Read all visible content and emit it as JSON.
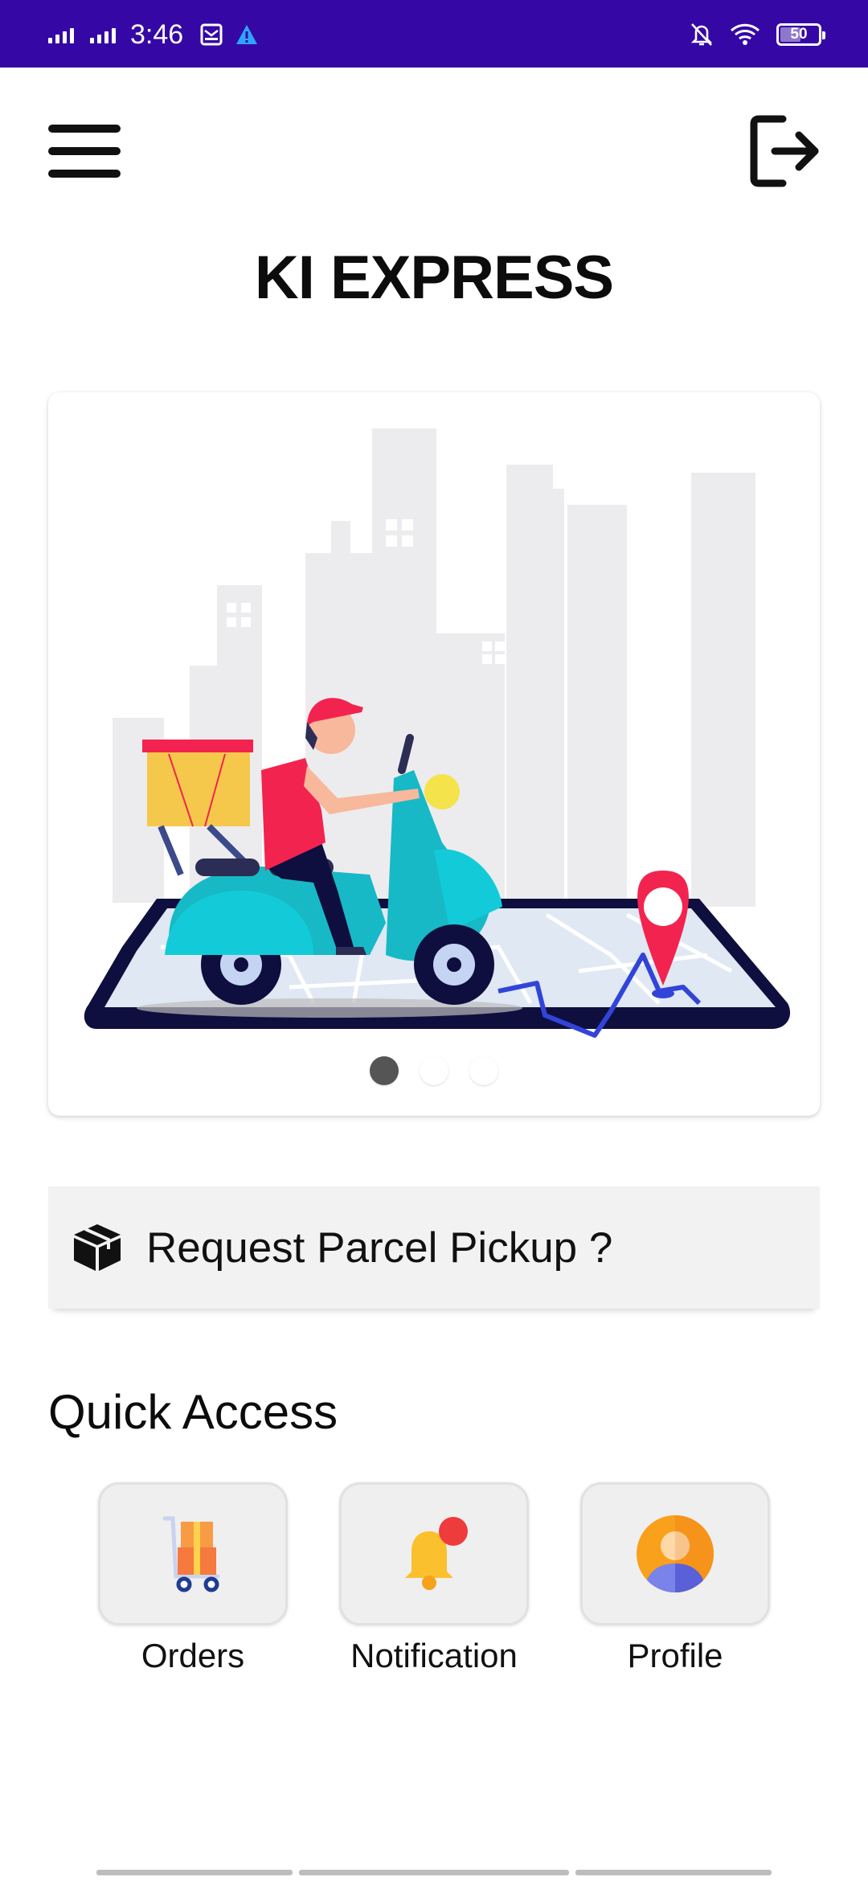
{
  "status_bar": {
    "time": "3:46",
    "battery": "50",
    "background_color": "#3508a6"
  },
  "header": {
    "menu_icon": "hamburger-menu-icon",
    "logout_icon": "logout-icon",
    "title": "KI EXPRESS"
  },
  "carousel": {
    "illustration": "delivery-scooter-illustration",
    "slide_count": 3,
    "active_slide": 1
  },
  "pickup": {
    "icon": "parcel-box-icon",
    "label": "Request Parcel Pickup ?"
  },
  "quick_access": {
    "title": "Quick Access",
    "items": [
      {
        "label": "Orders",
        "icon": "parcel-trolley-icon"
      },
      {
        "label": "Notification",
        "icon": "bell-icon"
      },
      {
        "label": "Profile",
        "icon": "user-avatar-icon"
      }
    ]
  },
  "colors": {
    "accent_red": "#f3234f",
    "scooter_teal": "#17b9c6",
    "bell_yellow": "#fbc02d",
    "avatar_orange": "#f9a11b"
  }
}
